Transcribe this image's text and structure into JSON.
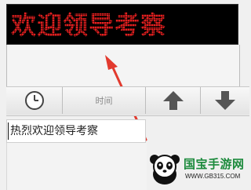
{
  "led_display": {
    "text": "欢迎领导考察",
    "color": "#e31f1f",
    "background": "#000000"
  },
  "toolbar": {
    "clock_icon": "clock-icon",
    "time_label": "时间",
    "up_icon": "arrow-up-icon",
    "down_icon": "arrow-down-icon"
  },
  "message_input": {
    "value": "热烈欢迎领导考察"
  },
  "annotation": {
    "arrow_color": "#e23a2e",
    "icon": "red-arrow-icon"
  },
  "watermark": {
    "name": "国宝手游网",
    "url": "WWW.GB315.COM",
    "icon": "panda-logo"
  }
}
